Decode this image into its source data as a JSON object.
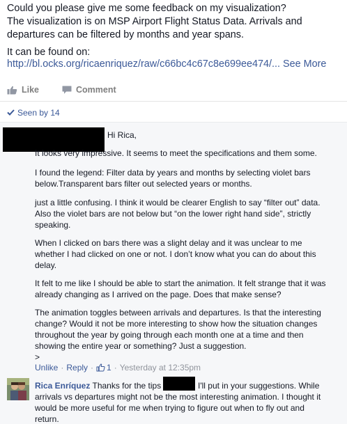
{
  "post": {
    "lines": [
      "Could you please give me some feedback on my visualization?",
      "The visualization is on MSP Airport Flight Status Data. Arrivals and",
      "departures can be filtered by months and year spans.",
      "It can be found on:"
    ],
    "link": "http://bl.ocks.org/ricaenriquez/raw/c66bc4c67c8e699ee474/...",
    "see_more": "See More"
  },
  "actions": {
    "like_label": "Like",
    "comment_label": "Comment"
  },
  "seen_by": "Seen by 14",
  "comment": {
    "greeting": "Hi Rica,",
    "lines": [
      "It looks very impressive. It seems to meet the specifications and them some.",
      "I found the legend: Filter data by years and months by selecting violet bars",
      "below.Transparent bars filter out selected years or months.",
      "just a little confusing. I think it would be clearer English to say “filter out” data.",
      "Also the violet bars are not below but “on the lower right hand side”, strictly",
      "speaking.",
      "When I clicked on bars there was a slight delay and it was unclear to me",
      "whether I had clicked on one or not. I don’t know what you can do about this",
      "delay.",
      "It felt to me like I should be able to start the animation. It felt strange that it was",
      "already changing as I arrived on the page. Does that make sense?",
      "The animation toggles between arrivals and departures. Is that the interesting",
      "change? Would it not be more interesting to show how the situation changes",
      "throughout the year by going through each month one at a time and then",
      "showing the entire year or something? Just a suggestion.",
      ">"
    ],
    "unlike": "Unlike",
    "reply": "Reply",
    "like_count": "1",
    "timestamp": "Yesterday at 12:35pm"
  },
  "reply": {
    "name": "Rica Enríquez",
    "text_start": "Thanks for the tips",
    "text_end": "I'll put in your suggestions. While",
    "lines": [
      "arrivals vs departures might not be the most interesting animation. I thought it",
      "would be more useful for me when trying to figure out when to fly out and",
      "return."
    ]
  },
  "colors": {
    "link": "#3b5998",
    "text": "#141823",
    "muted": "#90949c",
    "thread_bg": "#f6f7f9",
    "redaction": "#000000"
  }
}
